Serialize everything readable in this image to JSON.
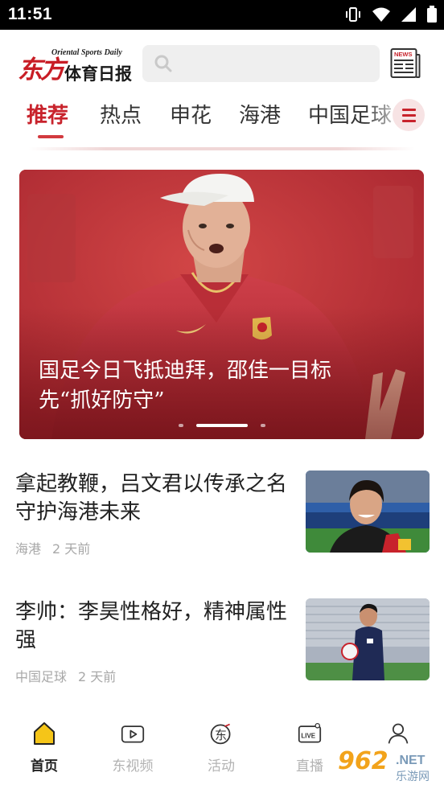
{
  "status_bar": {
    "time": "11:51",
    "icons": [
      "vibrate-icon",
      "wifi-icon",
      "signal-icon",
      "battery-icon"
    ]
  },
  "header": {
    "logo_cn_brand": "东方",
    "logo_cn_name": "体育日报",
    "logo_en": "Oriental Sports Daily",
    "news_icon_label": "NEWS",
    "search_placeholder": ""
  },
  "tabs": [
    {
      "label": "推荐",
      "active": true
    },
    {
      "label": "热点",
      "active": false
    },
    {
      "label": "申花",
      "active": false
    },
    {
      "label": "海港",
      "active": false
    },
    {
      "label": "中国足球",
      "active": false
    }
  ],
  "hero": {
    "title": "国足今日飞抵迪拜，邵佳一目标先“抓好防守”",
    "slide_count": 3,
    "active_slide": 2
  },
  "articles": [
    {
      "headline": "拿起教鞭，吕文君以传承之名守护海港未来",
      "category": "海港",
      "time": "2 天前"
    },
    {
      "headline": "李帅：李昊性格好，精神属性强",
      "category": "中国足球",
      "time": "2 天前"
    }
  ],
  "bottom_nav": [
    {
      "label": "首页",
      "icon": "home-icon",
      "active": true
    },
    {
      "label": "东视频",
      "icon": "video-icon",
      "active": false
    },
    {
      "label": "活动",
      "icon": "activity-icon",
      "active": false,
      "icon_text": "东"
    },
    {
      "label": "直播",
      "icon": "live-icon",
      "active": false,
      "icon_text": "LIVE"
    },
    {
      "label": "",
      "icon": "profile-icon",
      "active": false
    }
  ],
  "watermark": {
    "number": "962",
    "suffix": ".NET",
    "cn": "乐游网"
  },
  "colors": {
    "brand_red": "#c8232c",
    "tab_active": "#c8232c",
    "meta_gray": "#a8a8a8",
    "home_icon_yellow": "#f5c518"
  }
}
